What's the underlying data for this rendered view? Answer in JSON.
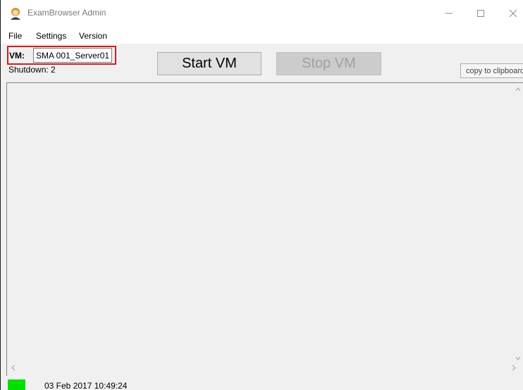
{
  "window": {
    "title": "ExamBrowser Admin",
    "controls": {
      "minimize": "—",
      "maximize": "☐",
      "close": "✕"
    }
  },
  "menu": {
    "items": [
      {
        "label": "File"
      },
      {
        "label": "Settings"
      },
      {
        "label": "Version"
      }
    ]
  },
  "vm": {
    "label": "VM:",
    "value": "SMA 001_Server01",
    "highlight_color": "#cc1f1f"
  },
  "shutdown": {
    "text": "Shutdown:  2"
  },
  "buttons": {
    "start_label": "Start VM",
    "stop_label": "Stop VM",
    "stop_enabled": false,
    "copy_label": "copy to clipboard"
  },
  "status": {
    "indicator_color": "#00e000",
    "timestamp": "03 Feb 2017 10:49:24"
  },
  "icons": {
    "app": "user-icon",
    "scroll_up": "chevron-up-icon",
    "scroll_down": "chevron-down-icon",
    "scroll_left": "chevron-left-icon",
    "scroll_right": "chevron-right-icon"
  }
}
